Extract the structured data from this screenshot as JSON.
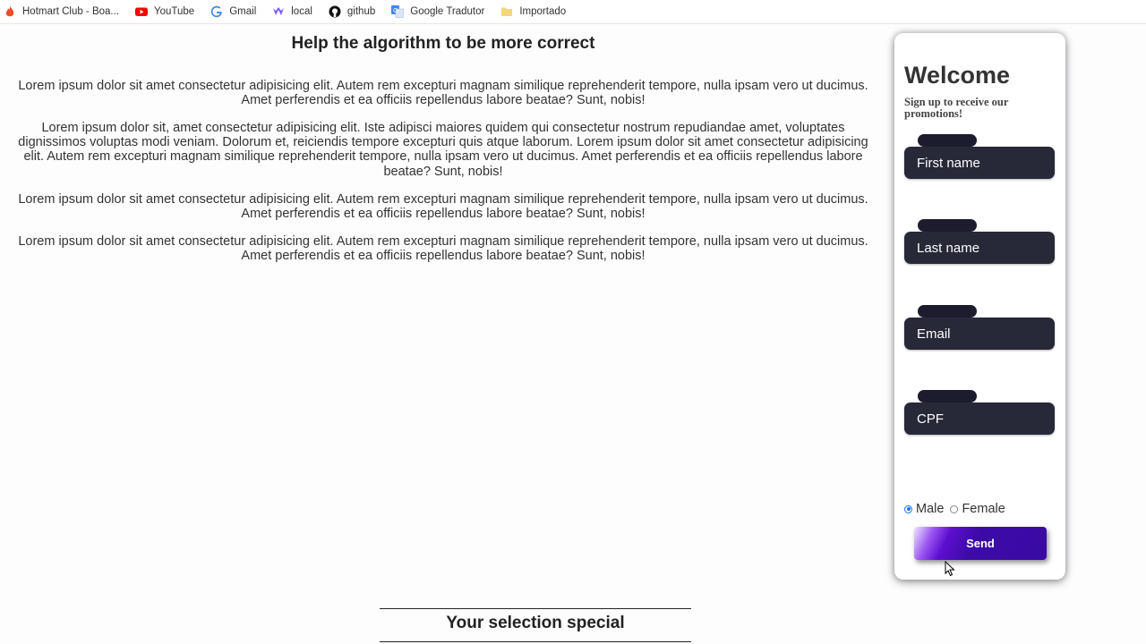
{
  "bookmarks": [
    {
      "label": "Hotmart Club - Boa...",
      "icon": "hotmart-icon"
    },
    {
      "label": "YouTube",
      "icon": "youtube-icon"
    },
    {
      "label": "Gmail",
      "icon": "google-icon"
    },
    {
      "label": "local",
      "icon": "local-icon"
    },
    {
      "label": "github",
      "icon": "github-icon"
    },
    {
      "label": "Google Tradutor",
      "icon": "translate-icon"
    },
    {
      "label": "Importado",
      "icon": "folder-icon"
    }
  ],
  "main": {
    "title": "Help the algorithm to be more correct",
    "paragraphs": [
      "Lorem ipsum dolor sit amet consectetur adipisicing elit. Autem rem excepturi magnam similique reprehenderit tempore, nulla ipsam vero ut ducimus. Amet perferendis et ea officiis repellendus labore beatae? Sunt, nobis!",
      "Lorem ipsum dolor sit, amet consectetur adipisicing elit. Iste adipisci maiores quidem qui consectetur nostrum repudiandae amet, voluptates dignissimos voluptas modi veniam. Dolorum et, reiciendis tempore excepturi quis atque laborum. Lorem ipsum dolor sit amet consectetur adipisicing elit. Autem rem excepturi magnam similique reprehenderit tempore, nulla ipsam vero ut ducimus. Amet perferendis et ea officiis repellendus labore beatae? Sunt, nobis!",
      "Lorem ipsum dolor sit amet consectetur adipisicing elit. Autem rem excepturi magnam similique reprehenderit tempore, nulla ipsam vero ut ducimus. Amet perferendis et ea officiis repellendus labore beatae? Sunt, nobis!",
      "Lorem ipsum dolor sit amet consectetur adipisicing elit. Autem rem excepturi magnam similique reprehenderit tempore, nulla ipsam vero ut ducimus. Amet perferendis et ea officiis repellendus labore beatae? Sunt, nobis!"
    ]
  },
  "form": {
    "title": "Welcome",
    "subtitle": "Sign up to receive our promotions!",
    "fields": [
      {
        "placeholder": "First name"
      },
      {
        "placeholder": "Last name"
      },
      {
        "placeholder": "Email"
      },
      {
        "placeholder": "CPF"
      }
    ],
    "gender": {
      "options": [
        "Male",
        "Female"
      ],
      "selected": "Male"
    },
    "send_label": "Send",
    "colors": {
      "field_bg": "#272838",
      "button_start": "#9a55f2",
      "button_end": "#3a0aa4"
    }
  },
  "section": {
    "title": "Your selection special"
  }
}
